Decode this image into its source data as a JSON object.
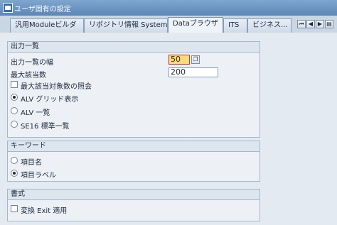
{
  "window": {
    "title": "ユーザ固有の設定"
  },
  "tabs": [
    {
      "label": "汎用Moduleビルダ",
      "active": false
    },
    {
      "label": "リポジトリ情報 System",
      "active": false
    },
    {
      "label": "Dataブラウザ",
      "active": true
    },
    {
      "label": "ITS",
      "active": false
    },
    {
      "label": "ビジネス...",
      "active": false
    }
  ],
  "tab_nav": {
    "first": "⏮",
    "prev": "◀",
    "next": "▶",
    "menu": "▤"
  },
  "output_list": {
    "header": "出力一覧",
    "width_label": "出力一覧の幅",
    "width_value": "50",
    "max_hits_label": "最大該当数",
    "max_hits_value": "200",
    "max_hits_query_label": "最大該当対象数の照会",
    "max_hits_query_checked": false,
    "display_options": [
      {
        "label": "ALV グリッド表示",
        "selected": true
      },
      {
        "label": "ALV 一覧",
        "selected": false
      },
      {
        "label": "SE16 標準一覧",
        "selected": false
      }
    ]
  },
  "keyword": {
    "header": "キーワード",
    "options": [
      {
        "label": "項目名",
        "selected": false
      },
      {
        "label": "項目ラベル",
        "selected": true
      }
    ]
  },
  "format": {
    "header": "書式",
    "exit_label": "変換 Exit 適用",
    "exit_checked": false
  }
}
